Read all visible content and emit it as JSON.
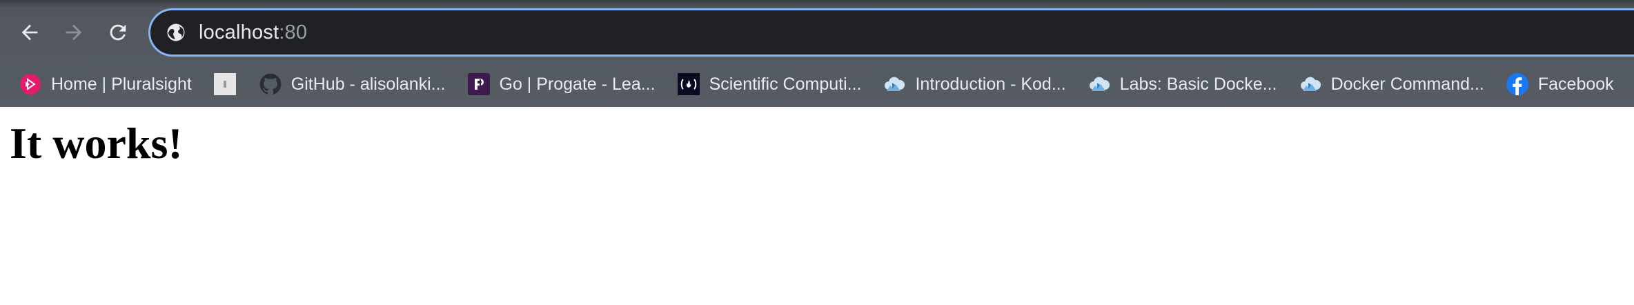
{
  "browser": {
    "address_bar": {
      "host": "localhost",
      "port": ":80"
    },
    "nav": {
      "back_icon": "arrow-left-icon",
      "forward_icon": "arrow-right-icon",
      "reload_icon": "reload-icon",
      "site_info_icon": "globe-icon"
    },
    "bookmarks": [
      {
        "label": "Home | Pluralsight",
        "icon": "pluralsight-icon"
      },
      {
        "label": "",
        "icon": "generic-page-icon"
      },
      {
        "label": "GitHub - alisolanki...",
        "icon": "github-icon"
      },
      {
        "label": "Go | Progate - Lea...",
        "icon": "progate-icon"
      },
      {
        "label": "Scientific Computi...",
        "icon": "freecodecamp-icon"
      },
      {
        "label": "Introduction - Kod...",
        "icon": "kodekloud-icon"
      },
      {
        "label": "Labs: Basic Docke...",
        "icon": "kodekloud-icon"
      },
      {
        "label": "Docker Command...",
        "icon": "kodekloud-icon"
      },
      {
        "label": "Facebook",
        "icon": "facebook-icon"
      }
    ],
    "colors": {
      "accent": "#8ab4f8",
      "omnibox_bg": "#202124",
      "chrome_bg": "#565c63"
    }
  },
  "page": {
    "heading": "It works!"
  }
}
